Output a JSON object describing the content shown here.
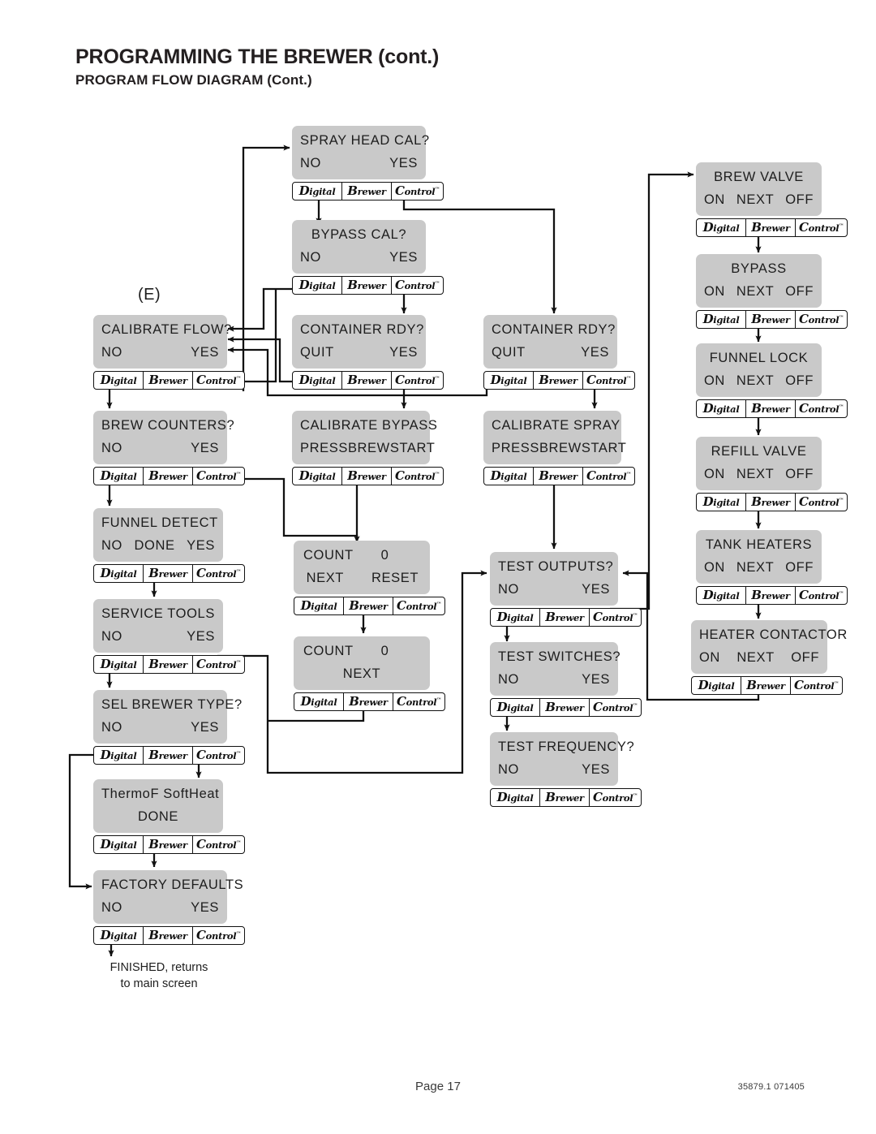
{
  "header": {
    "title": "PROGRAMMING THE BREWER (cont.)",
    "subtitle": "PROGRAM FLOW DIAGRAM (Cont.)"
  },
  "badge": {
    "cell1": "Digital",
    "cell2": "Brewer",
    "cell3": "Control",
    "tm": "™"
  },
  "labels": {
    "entry_tag": "(E)",
    "finished_line1": "FINISHED, returns",
    "finished_line2": "to main screen"
  },
  "footer": {
    "page": "Page 17",
    "doc_code": "35879.1 071405"
  },
  "nodes": {
    "spray_head_cal": {
      "title": "SPRAY HEAD CAL?",
      "left": "NO",
      "right": "YES"
    },
    "bypass_cal": {
      "title": "BYPASS CAL?",
      "left": "NO",
      "right": "YES"
    },
    "calibrate_flow": {
      "title": "CALIBRATE FLOW?",
      "left": "NO",
      "right": "YES"
    },
    "container_rdy_mid": {
      "title": "CONTAINER RDY?",
      "left": "QUIT",
      "right": "YES"
    },
    "container_rdy_right": {
      "title": "CONTAINER RDY?",
      "left": "QUIT",
      "right": "YES"
    },
    "brew_counters": {
      "title": "BREW COUNTERS?",
      "left": "NO",
      "right": "YES"
    },
    "calibrate_bypass": {
      "title": "CALIBRATE BYPASS",
      "left": "PRESS",
      "mid": "BREW",
      "right": "START"
    },
    "calibrate_spray": {
      "title": "CALIBRATE SPRAY",
      "left": "PRESS",
      "mid": "BREW",
      "right": "START"
    },
    "funnel_detect": {
      "title": "FUNNEL DETECT",
      "left": "NO",
      "mid": "DONE",
      "right": "YES"
    },
    "service_tools": {
      "title": "SERVICE TOOLS",
      "left": "NO",
      "right": "YES"
    },
    "count_reset": {
      "title": "COUNT",
      "value": "0",
      "mid": "NEXT",
      "right": "RESET"
    },
    "count_next": {
      "title": "COUNT",
      "value": "0",
      "mid": "NEXT"
    },
    "test_outputs": {
      "title": "TEST OUTPUTS?",
      "left": "NO",
      "right": "YES"
    },
    "test_switches": {
      "title": "TEST SWITCHES?",
      "left": "NO",
      "right": "YES"
    },
    "test_frequency": {
      "title": "TEST FREQUENCY?",
      "left": "NO",
      "right": "YES"
    },
    "sel_brewer_type": {
      "title": "SEL BREWER TYPE?",
      "left": "NO",
      "right": "YES"
    },
    "thermof_softheat": {
      "title": "ThermoF SoftHeat",
      "mid": "DONE"
    },
    "factory_defaults": {
      "title": "FACTORY DEFAULTS",
      "left": "NO",
      "right": "YES"
    },
    "brew_valve": {
      "title": "BREW VALVE",
      "left": "ON",
      "mid": "NEXT",
      "right": "OFF"
    },
    "bypass": {
      "title": "BYPASS",
      "left": "ON",
      "mid": "NEXT",
      "right": "OFF"
    },
    "funnel_lock": {
      "title": "FUNNEL LOCK",
      "left": "ON",
      "mid": "NEXT",
      "right": "OFF"
    },
    "refill_valve": {
      "title": "REFILL VALVE",
      "left": "ON",
      "mid": "NEXT",
      "right": "OFF"
    },
    "tank_heaters": {
      "title": "TANK HEATERS",
      "left": "ON",
      "mid": "NEXT",
      "right": "OFF"
    },
    "heater_contactor": {
      "title": "HEATER CONTACTOR",
      "left": "ON",
      "mid": "NEXT",
      "right": "OFF"
    }
  },
  "colors": {
    "screen_fill": "#c9c9c9",
    "ink": "#1d1d1d",
    "wire": "#111111"
  }
}
